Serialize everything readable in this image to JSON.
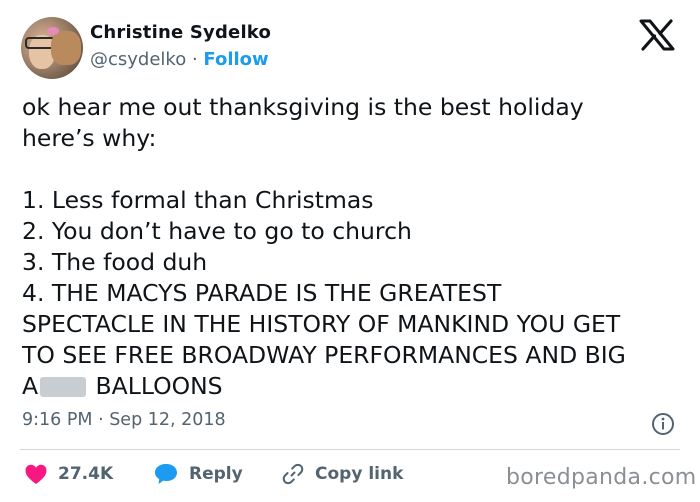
{
  "user": {
    "display_name": "Christine Sydelko",
    "handle": "@csydelko",
    "separator": " · ",
    "follow_label": "Follow",
    "avatar_icon": "profile-photo-with-dog"
  },
  "platform": {
    "logo_icon": "x-logo"
  },
  "tweet": {
    "text_before": "ok hear me out thanksgiving is the best holiday\nhere’s why:\n\n1. Less formal than Christmas\n2. You don’t have to go to church\n3. The food duh\n4. THE MACYS PARADE IS THE GREATEST\nSPECTACLE IN THE HISTORY OF MANKIND YOU GET\nTO SEE FREE BROADWAY PERFORMANCES AND BIG\nA",
    "censored_icon": "blurred-word",
    "text_after": " BALLOONS",
    "timestamp": "9:16 PM · Sep 12, 2018"
  },
  "actions": {
    "likes_count": "27.4K",
    "reply_label": "Reply",
    "copy_label": "Copy link"
  },
  "watermark": "boredpanda.com",
  "colors": {
    "accent": "#1d9bf0",
    "like": "#f91880",
    "muted": "#536471",
    "text": "#0f1419"
  }
}
